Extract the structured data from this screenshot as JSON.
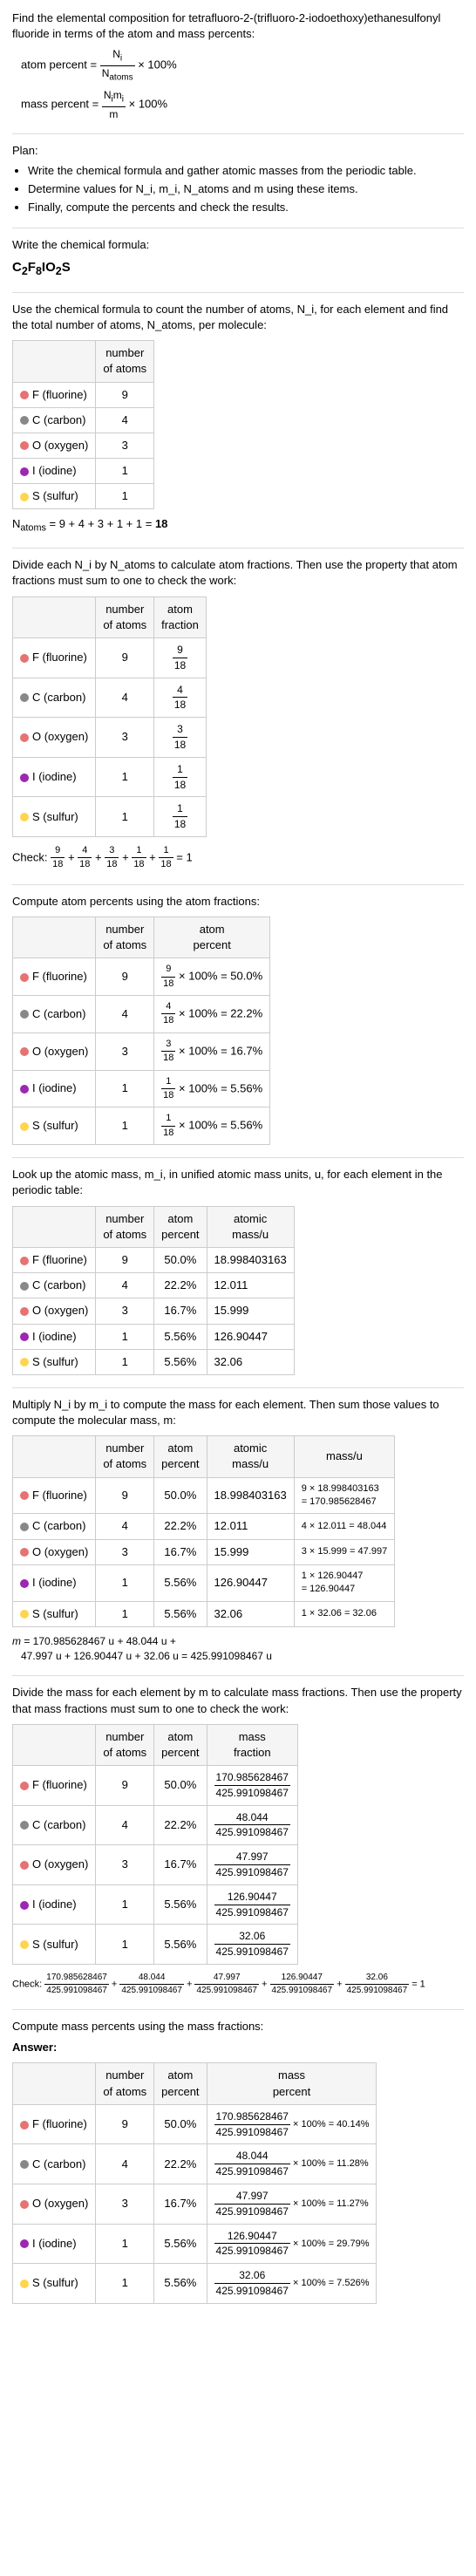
{
  "title": "Find the elemental composition for tetrafluoro-2-(trifluoro-2-iodoethoxy)ethanesulfonyl fluoride",
  "intro_text": "Find the elemental composition for tetrafluoro-2-(trifluoro-2-iodoethoxy)ethanesulfonyl fluoride in terms of the atom and mass percents:",
  "formulas": {
    "atom_percent": "atom percent = (N_i / N_atoms) × 100%",
    "mass_percent": "mass percent = (N_i m_i / m) × 100%"
  },
  "plan_header": "Plan:",
  "plan_items": [
    "Write the chemical formula and gather atomic masses from the periodic table.",
    "Determine values for N_i, m_i, N_atoms and m using these items.",
    "Finally, compute the percents and check the results."
  ],
  "write_formula_label": "Write the chemical formula:",
  "chemical_formula": "C₂F₈IO₂S",
  "use_formula_label": "Use the chemical formula to count the number of atoms, N_i, for each element and find the total number of atoms, N_atoms, per molecule:",
  "table1": {
    "headers": [
      "",
      "number of atoms"
    ],
    "rows": [
      {
        "element": "F (fluorine)",
        "dot": "f",
        "value": "9"
      },
      {
        "element": "C (carbon)",
        "dot": "c",
        "value": "4"
      },
      {
        "element": "O (oxygen)",
        "dot": "o",
        "value": "3"
      },
      {
        "element": "I (iodine)",
        "dot": "i",
        "value": "1"
      },
      {
        "element": "S (sulfur)",
        "dot": "s",
        "value": "1"
      }
    ]
  },
  "natoms_eq": "N_atoms = 9 + 4 + 3 + 1 + 1 = 18",
  "divide_text": "Divide each N_i by N_atoms to calculate atom fractions. Then use the property that atom fractions must sum to one to check the work:",
  "table2": {
    "headers": [
      "",
      "number of atoms",
      "atom fraction"
    ],
    "rows": [
      {
        "element": "F (fluorine)",
        "dot": "f",
        "n": "9",
        "frac_num": "9",
        "frac_den": "18"
      },
      {
        "element": "C (carbon)",
        "dot": "c",
        "n": "4",
        "frac_num": "4",
        "frac_den": "18"
      },
      {
        "element": "O (oxygen)",
        "dot": "o",
        "n": "3",
        "frac_num": "3",
        "frac_den": "18"
      },
      {
        "element": "I (iodine)",
        "dot": "i",
        "n": "1",
        "frac_num": "1",
        "frac_den": "18"
      },
      {
        "element": "S (sulfur)",
        "dot": "s",
        "n": "1",
        "frac_num": "1",
        "frac_den": "18"
      }
    ]
  },
  "check1": "Check: 9/18 + 4/18 + 3/18 + 1/18 + 1/18 = 1",
  "compute_atom_percent_label": "Compute atom percents using the atom fractions:",
  "table3": {
    "headers": [
      "",
      "number of atoms",
      "atom percent"
    ],
    "rows": [
      {
        "element": "F (fluorine)",
        "dot": "f",
        "n": "9",
        "expr": "9/18 × 100% = 50.0%"
      },
      {
        "element": "C (carbon)",
        "dot": "c",
        "n": "4",
        "expr": "4/18 × 100% = 22.2%"
      },
      {
        "element": "O (oxygen)",
        "dot": "o",
        "n": "3",
        "expr": "3/18 × 100% = 16.7%"
      },
      {
        "element": "I (iodine)",
        "dot": "i",
        "n": "1",
        "expr": "1/18 × 100% = 5.56%"
      },
      {
        "element": "S (sulfur)",
        "dot": "s",
        "n": "1",
        "expr": "1/18 × 100% = 5.56%"
      }
    ]
  },
  "lookup_text": "Look up the atomic mass, m_i, in unified atomic mass units, u, for each element in the periodic table:",
  "table4": {
    "headers": [
      "",
      "number of atoms",
      "atom percent",
      "atomic mass/u"
    ],
    "rows": [
      {
        "element": "F (fluorine)",
        "dot": "f",
        "n": "9",
        "ap": "50.0%",
        "am": "18.998403163"
      },
      {
        "element": "C (carbon)",
        "dot": "c",
        "n": "4",
        "ap": "22.2%",
        "am": "12.011"
      },
      {
        "element": "O (oxygen)",
        "dot": "o",
        "n": "3",
        "ap": "16.7%",
        "am": "15.999"
      },
      {
        "element": "I (iodine)",
        "dot": "i",
        "n": "1",
        "ap": "5.56%",
        "am": "126.90447"
      },
      {
        "element": "S (sulfur)",
        "dot": "s",
        "n": "1",
        "ap": "5.56%",
        "am": "32.06"
      }
    ]
  },
  "multiply_text": "Multiply N_i by m_i to compute the mass for each element. Then sum those values to compute the molecular mass, m:",
  "table5": {
    "headers": [
      "",
      "number of atoms",
      "atom percent",
      "atomic mass/u",
      "mass/u"
    ],
    "rows": [
      {
        "element": "F (fluorine)",
        "dot": "f",
        "n": "9",
        "ap": "50.0%",
        "am": "18.998403163",
        "mass": "9 × 18.998403163 = 170.985628467"
      },
      {
        "element": "C (carbon)",
        "dot": "c",
        "n": "4",
        "ap": "22.2%",
        "am": "12.011",
        "mass": "4 × 12.011 = 48.044"
      },
      {
        "element": "O (oxygen)",
        "dot": "o",
        "n": "3",
        "ap": "16.7%",
        "am": "15.999",
        "mass": "3 × 15.999 = 47.997"
      },
      {
        "element": "I (iodine)",
        "dot": "i",
        "n": "1",
        "ap": "5.56%",
        "am": "126.90447",
        "mass": "1 × 126.90447 = 126.90447"
      },
      {
        "element": "S (sulfur)",
        "dot": "s",
        "n": "1",
        "ap": "5.56%",
        "am": "32.06",
        "mass": "1 × 32.06 = 32.06"
      }
    ]
  },
  "m_eq": "m = 170.985628467 u + 48.044 u + 47.997 u + 126.90447 u + 32.06 u = 425.991098467 u",
  "divide_mass_text": "Divide the mass for each element by m to calculate mass fractions. Then use the property that mass fractions must sum to one to check the work:",
  "table6": {
    "headers": [
      "",
      "number of atoms",
      "atom percent",
      "mass fraction"
    ],
    "rows": [
      {
        "element": "F (fluorine)",
        "dot": "f",
        "n": "9",
        "ap": "50.0%",
        "mf": "170.985628467 / 425.991098467"
      },
      {
        "element": "C (carbon)",
        "dot": "c",
        "n": "4",
        "ap": "22.2%",
        "mf": "48.044 / 425.991098467"
      },
      {
        "element": "O (oxygen)",
        "dot": "o",
        "n": "3",
        "ap": "16.7%",
        "mf": "47.997 / 425.991098467"
      },
      {
        "element": "I (iodine)",
        "dot": "i",
        "n": "1",
        "ap": "5.56%",
        "mf": "126.90447 / 425.991098467"
      },
      {
        "element": "S (sulfur)",
        "dot": "s",
        "n": "1",
        "ap": "5.56%",
        "mf": "32.06 / 425.991098467"
      }
    ]
  },
  "check2": "Check: 170.985628467/425.991098467 + 48.044/425.991098467 + 47.997/425.991098467 + 126.90447/425.991098467 + 32.06/425.991098467 = 1",
  "compute_mass_percent_label": "Compute mass percents using the mass fractions:",
  "answer_label": "Answer:",
  "table7": {
    "headers": [
      "",
      "number of atoms",
      "atom percent",
      "mass percent"
    ],
    "rows": [
      {
        "element": "F (fluorine)",
        "dot": "f",
        "n": "9",
        "ap": "50.0%",
        "mp": "170.985628467 / 425.991098467 × 100% = 40.14%"
      },
      {
        "element": "C (carbon)",
        "dot": "c",
        "n": "4",
        "ap": "22.2%",
        "mp": "48.044 / 425.991098467 × 100% = 11.28%"
      },
      {
        "element": "O (oxygen)",
        "dot": "o",
        "n": "3",
        "ap": "16.7%",
        "mp": "47.997 / 425.991098467 × 100% = 11.27%"
      },
      {
        "element": "I (iodine)",
        "dot": "i",
        "n": "1",
        "ap": "5.56%",
        "mp": "126.90447 / 425.991098467 × 100% = 29.79%"
      },
      {
        "element": "S (sulfur)",
        "dot": "s",
        "n": "1",
        "ap": "5.56%",
        "mp": "32.06 / 425.991098467 × 100% = 7.526%"
      }
    ]
  }
}
